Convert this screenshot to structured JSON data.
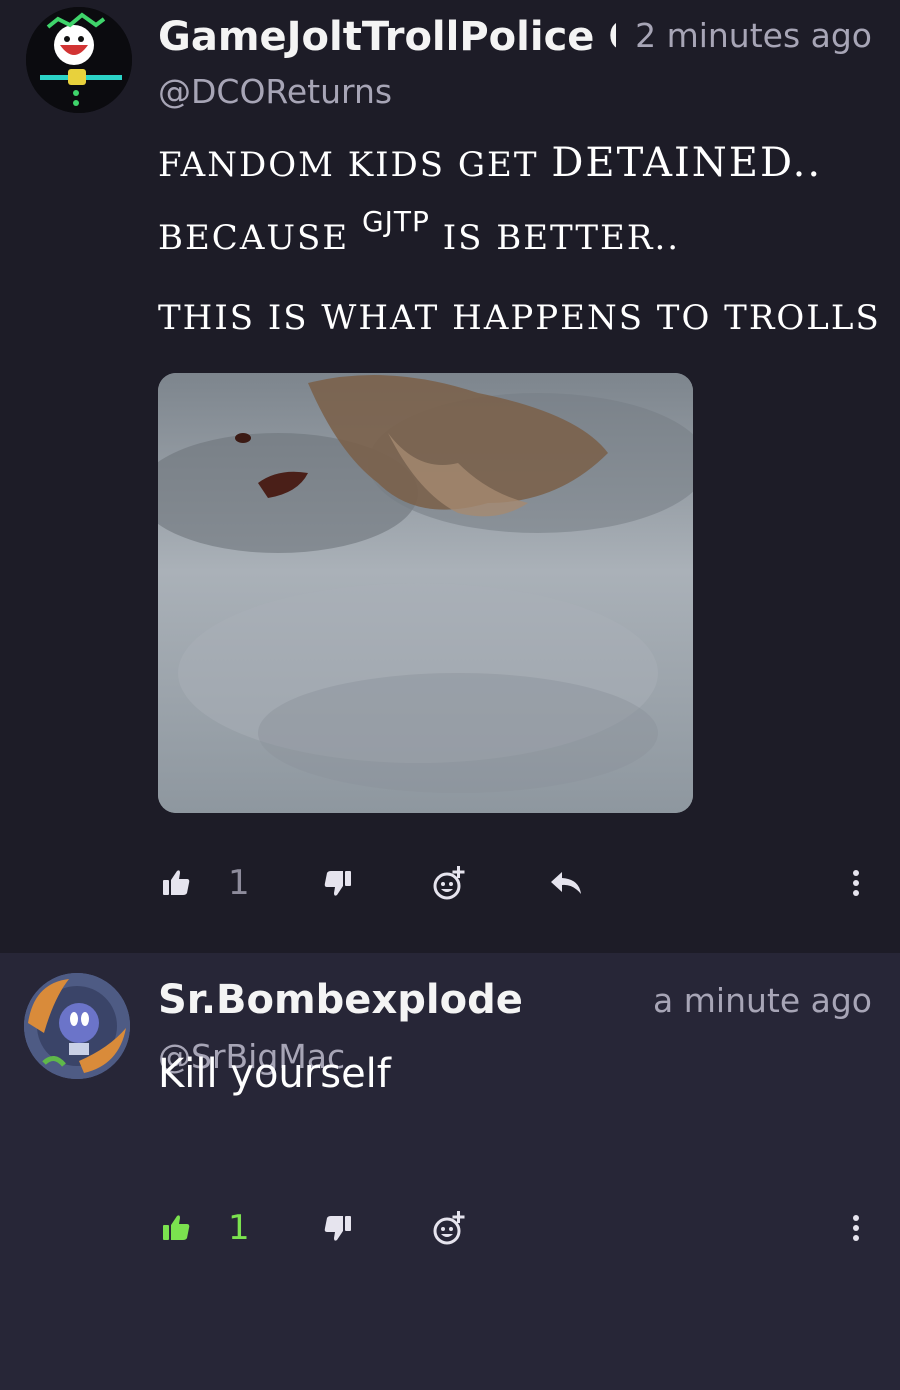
{
  "comments": [
    {
      "author": "GameJoltTrollPolice Ge",
      "handle": "@DCOReturns",
      "time": "2 minutes ago",
      "lines": {
        "l1_a": "FANDOM KIDS GET ",
        "l1_b": "DETAINED..",
        "l2_a": "BECAUSE ",
        "l2_b": "GJTP",
        "l2_c": " IS BETTER..",
        "l3": "THIS IS WHAT HAPPENS TO TROLLS"
      },
      "likes": "1",
      "liked": false
    },
    {
      "author": "Sr.Bombexplode",
      "handle": "@SrBigMac",
      "time": "a minute ago",
      "text": "Kill yourself",
      "likes": "1",
      "liked": true
    }
  ],
  "icons": {
    "like": "thumbs-up-icon",
    "dislike": "thumbs-down-icon",
    "react": "add-reaction-icon",
    "reply": "reply-icon",
    "more": "more-vertical-icon"
  },
  "colors": {
    "background_top": "#1d1c27",
    "background_bottom": "#272637",
    "muted_text": "#a7a5b6",
    "like_active": "#7be24f"
  }
}
